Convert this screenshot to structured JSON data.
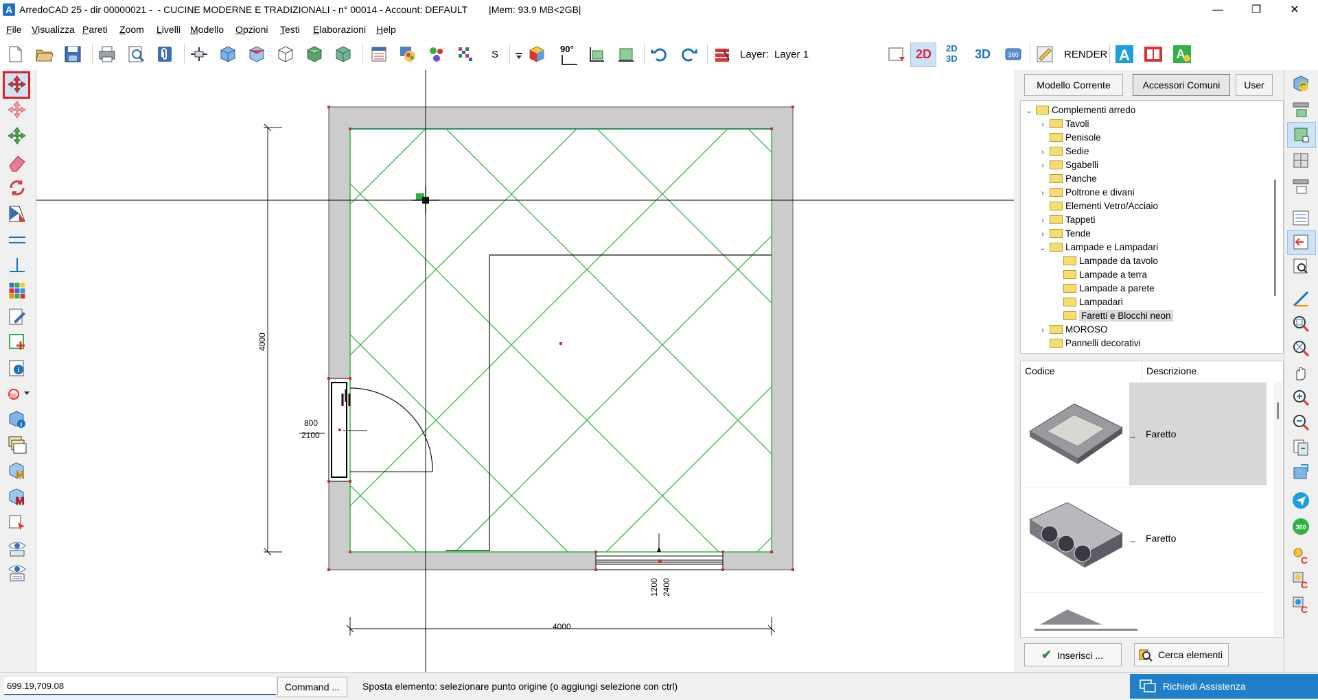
{
  "window": {
    "title": "ArredoCAD 25 - dir 00000021 -  - CUCINE MODERNE E TRADIZIONALI - n° 00014 - Account: DEFAULT        |Mem: 93.9 MB<2GB|",
    "logo_letter": "A",
    "minimize_glyph": "—",
    "maximize_glyph": "❐",
    "close_glyph": "✕"
  },
  "menu": {
    "items": [
      "File",
      "Visualizza",
      "Pareti",
      "Zoom",
      "Livelli",
      "Modello",
      "Opzioni",
      "Testi",
      "Elaborazioni",
      "Help"
    ]
  },
  "toolbar": {
    "s_label": "S",
    "rotate_label": "90°",
    "layer_label": "Layer:",
    "layer_value": "Layer 1",
    "view_2d": "2D",
    "view_2d3d_top": "2D",
    "view_2d3d_bottom": "3D",
    "view_3d": "3D",
    "render_label": "RENDER",
    "accent_color": "#1e73c8",
    "active_view_color": "#d7263d"
  },
  "drawing": {
    "dim_height": "4000",
    "dim_width": "4000",
    "door_width": "800",
    "door_height": "2100",
    "window_width": "1200",
    "window_height": "2400",
    "wall_color": "#cccccc",
    "tile_color": "#33b33d",
    "axis_color": "#000000",
    "top_wall_line_color": "#1f1fcf"
  },
  "panel": {
    "tabs": [
      "Modello Corrente",
      "Accessori Comuni",
      "User"
    ],
    "active_tab": "Accessori Comuni",
    "tree": [
      {
        "label": "Complementi arredo",
        "level": 0,
        "expander": "⌄",
        "open": true
      },
      {
        "label": "Tavoli",
        "level": 1,
        "expander": "›"
      },
      {
        "label": "Penisole",
        "level": 1,
        "expander": ""
      },
      {
        "label": "Sedie",
        "level": 1,
        "expander": "›"
      },
      {
        "label": "Sgabelli",
        "level": 1,
        "expander": "›"
      },
      {
        "label": "Panche",
        "level": 1,
        "expander": ""
      },
      {
        "label": "Poltrone e divani",
        "level": 1,
        "expander": "›"
      },
      {
        "label": "Elementi Vetro/Acciaio",
        "level": 1,
        "expander": ""
      },
      {
        "label": "Tappeti",
        "level": 1,
        "expander": "›"
      },
      {
        "label": "Tende",
        "level": 1,
        "expander": "›"
      },
      {
        "label": "Lampade e Lampadari",
        "level": 1,
        "expander": "⌄",
        "open": true
      },
      {
        "label": "Lampade da tavolo",
        "level": 2,
        "expander": ""
      },
      {
        "label": "Lampade a terra",
        "level": 2,
        "expander": ""
      },
      {
        "label": "Lampade a parete",
        "level": 2,
        "expander": ""
      },
      {
        "label": "Lampadari",
        "level": 2,
        "expander": ""
      },
      {
        "label": "Faretti e Blocchi neon",
        "level": 2,
        "expander": "",
        "selected": true
      },
      {
        "label": "MOROSO",
        "level": 1,
        "expander": "›"
      },
      {
        "label": "Pannelli decorativi",
        "level": 1,
        "expander": ""
      }
    ],
    "columns": {
      "code": "Codice",
      "description": "Descrizione"
    },
    "rows": [
      {
        "code": "_",
        "description": "Faretto",
        "selected": true
      },
      {
        "code": "_",
        "description": "Faretto",
        "selected": false
      },
      {
        "code": "",
        "description": "",
        "selected": false
      }
    ],
    "insert_button": "Inserisci ...",
    "search_button": "Cerca elementi"
  },
  "status": {
    "coordinates": "699.19,709.08",
    "command_button": "Command ...",
    "message": "Sposta elemento: selezionare punto origine (o aggiungi selezione con ctrl)",
    "assist_button": "Richiedi Assistenza",
    "assist_color": "#1f7fc8"
  }
}
